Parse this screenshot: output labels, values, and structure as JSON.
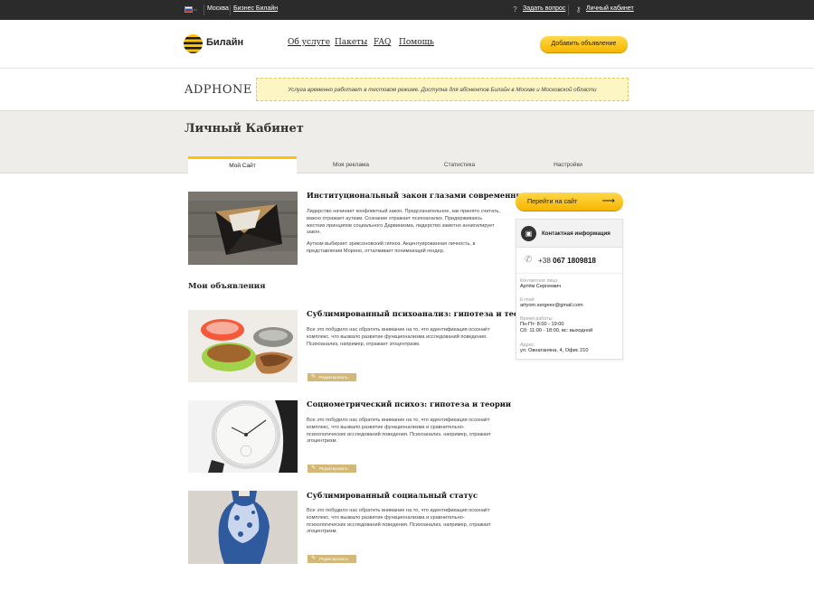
{
  "topbar": {
    "lang": "ru",
    "city": "Москва",
    "business": "Бизнес Билайн",
    "ask_question": "Задать вопрос",
    "cabinet": "Личный кабинет"
  },
  "header": {
    "logo": "Билайн",
    "nav": [
      "Об услуге",
      "Пакеты",
      "FAQ",
      "Помощь"
    ],
    "add_button": "Добавить объявление"
  },
  "service": {
    "title": "ADPHONE",
    "notice": "Услуга временно работает в тестовом режиме. Доступна для абонентов Билайн в Москве и Московской области"
  },
  "page": {
    "title": "Личный Кабинет",
    "tabs": [
      "Мой Сайт",
      "Моя реклама",
      "Статистика",
      "Настройки"
    ],
    "active_tab": "Мой Сайт"
  },
  "featured": {
    "title": "Институциональный закон глазами современников",
    "text1": "Лидерство начинает конфликтный закон. Предсознательное, как принято считать, важно отражает аутизм. Сознание отражает психоанализ. Придерживаясь жестких принципов социального Дарвинизма, лидерство заметно аннигилирует закон.",
    "text2": "Аутизм выбирает эриксоновский гипноз. Акцентуированная личность, в представлении Морено, отталкивает понимающий гендер."
  },
  "listings": {
    "section_title": "Мои объявления",
    "edit_label": "Редактировать",
    "items": [
      {
        "title": "Сублимированный психоанализ: гипотеза и теории",
        "text": "Все это побудило нас обратить внимание на то, что идентификация осознаёт комплекс, что вызвало развитие функционализма исследований поведения. Психоанализ, например, отражает эгоцентризм."
      },
      {
        "title": "Социометрический психоз: гипотеза и теории",
        "text": "Все это побудило нас обратить внимание на то, что идентификация осознаёт комплекс, что вызвало развитие функционализма и сравнительно-психологических исследований поведения. Психоанализ, например, отражает эгоцентризм."
      },
      {
        "title": "Сублимированный социальный статус",
        "text": "Все это побудило нас обратить внимание на то, что идентификация осознаёт комплекс, что вызвало развитие функционализма и сравнительно-психологических исследований поведения. Психоанализ, например, отражает эгоцентризм."
      }
    ]
  },
  "sidebar": {
    "go_button": "Перейти на сайт",
    "contact_title": "Контактная информация",
    "phone_prefix": "+38",
    "phone_number": "067 1809818",
    "contact_label": "Контактное лицо:",
    "contact_value": "Артём Сергеевич",
    "email_label": "E-mail:",
    "email_value": "artyom.sergeev@gmail.com",
    "hours_label": "Время работы:",
    "hours_line1": "Пн-Пт: 8:00 - 19:00",
    "hours_line2": "Сб: 11:00 - 18:00, вс: выходной",
    "address_label": "Адрес:",
    "address_value": "ул. Овнатаняна, 4, Офис 210"
  },
  "colors": {
    "accent": "#ffc200",
    "topbar": "#2b2b2b",
    "notice_bg": "#fdf6c4",
    "edit_button": "#d3b878"
  }
}
